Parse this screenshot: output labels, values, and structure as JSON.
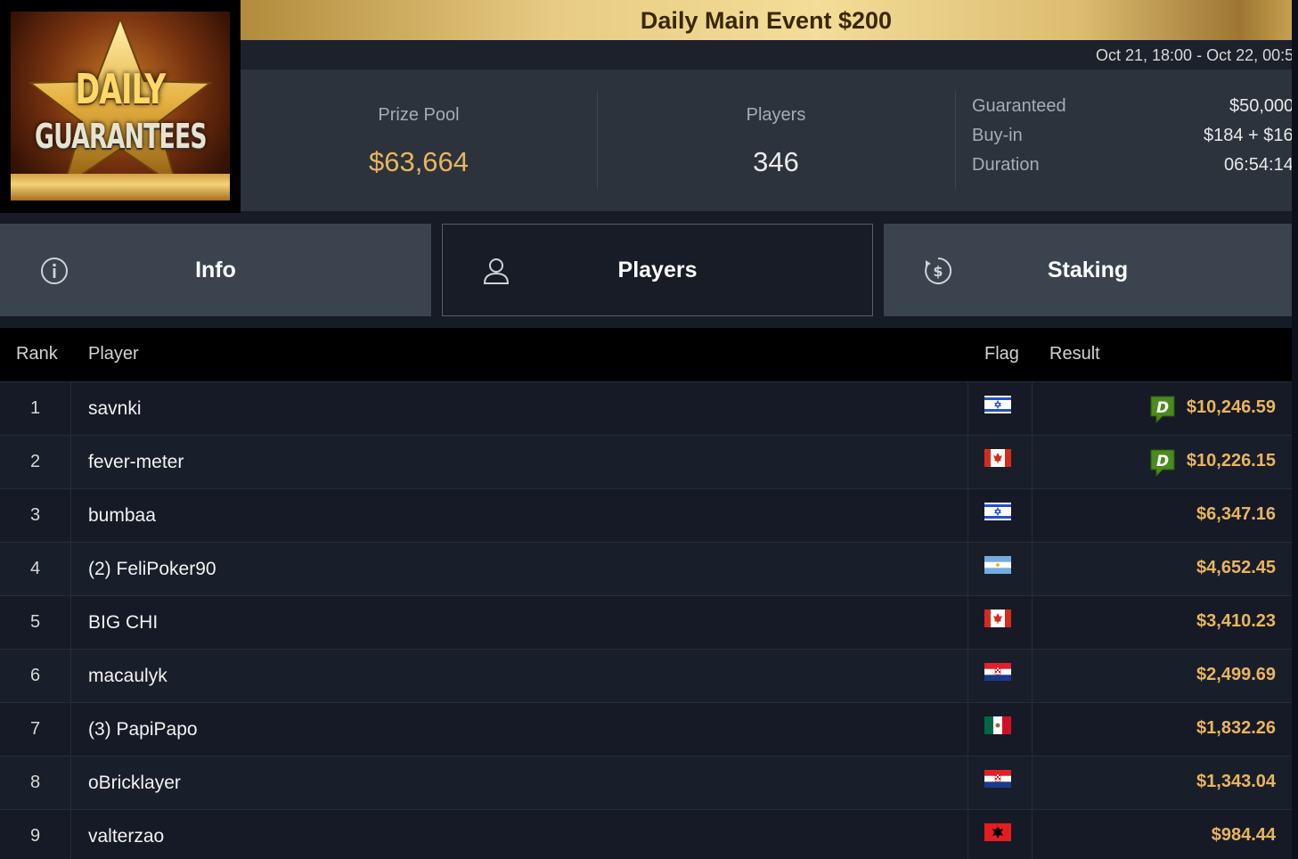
{
  "logo": {
    "line1": "DAILY",
    "line2": "GUARANTEES"
  },
  "header": {
    "title": "Daily Main Event $200",
    "date_range": "Oct 21, 18:00 - Oct 22, 00:5"
  },
  "stats": {
    "prize_pool_label": "Prize Pool",
    "prize_pool_value": "$63,664",
    "players_label": "Players",
    "players_value": "346"
  },
  "details": [
    {
      "label": "Guaranteed",
      "value": "$50,000"
    },
    {
      "label": "Buy-in",
      "value": "$184 + $16"
    },
    {
      "label": "Duration",
      "value": "06:54:14"
    }
  ],
  "tabs": [
    {
      "label": "Info",
      "icon": "info-icon"
    },
    {
      "label": "Players",
      "icon": "user-icon",
      "active": true
    },
    {
      "label": "Staking",
      "icon": "dollar-cycle-icon"
    }
  ],
  "table": {
    "headers": {
      "rank": "Rank",
      "player": "Player",
      "flag": "Flag",
      "result": "Result"
    },
    "rows": [
      {
        "rank": "1",
        "player": "savnki",
        "flag": "israel",
        "result": "$10,246.59",
        "staking_badge": "D"
      },
      {
        "rank": "2",
        "player": "fever-meter",
        "flag": "canada",
        "result": "$10,226.15",
        "staking_badge": "D"
      },
      {
        "rank": "3",
        "player": "bumbaa",
        "flag": "israel",
        "result": "$6,347.16"
      },
      {
        "rank": "4",
        "player": "(2) FeliPoker90",
        "flag": "argentina",
        "result": "$4,652.45"
      },
      {
        "rank": "5",
        "player": "BIG CHI",
        "flag": "canada",
        "result": "$3,410.23"
      },
      {
        "rank": "6",
        "player": "macaulyk",
        "flag": "croatia",
        "result": "$2,499.69"
      },
      {
        "rank": "7",
        "player": "(3) PapiPapo",
        "flag": "mexico",
        "result": "$1,832.26"
      },
      {
        "rank": "8",
        "player": "oBricklayer",
        "flag": "croatia",
        "result": "$1,343.04"
      },
      {
        "rank": "9",
        "player": "valterzao",
        "flag": "albania",
        "result": "$984.44"
      }
    ]
  },
  "colors": {
    "accent_gold": "#e9b55d",
    "background": "#0d0f1a",
    "panel": "#2c333d",
    "badge_green": "#4a8a1e"
  }
}
